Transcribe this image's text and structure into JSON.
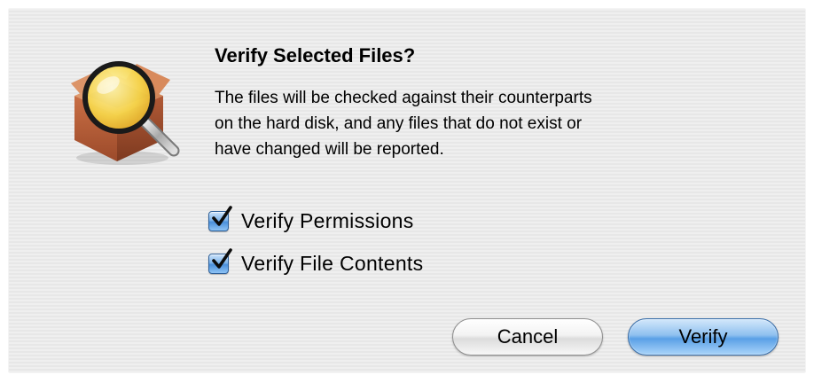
{
  "dialog": {
    "icon": "package-magnifier-icon",
    "title": "Verify Selected Files?",
    "message_lines": [
      "The files will be checked against their counterparts",
      "on the hard disk, and any files that do not exist or",
      "have changed will be reported."
    ],
    "options": [
      {
        "label": "Verify Permissions",
        "checked": true
      },
      {
        "label": "Verify File Contents",
        "checked": true
      }
    ],
    "buttons": {
      "cancel": "Cancel",
      "verify": "Verify"
    }
  },
  "colors": {
    "dialog_background": "#ececec",
    "default_button": "#5aa0e6",
    "checkbox_fill": "#4a8fdb"
  }
}
